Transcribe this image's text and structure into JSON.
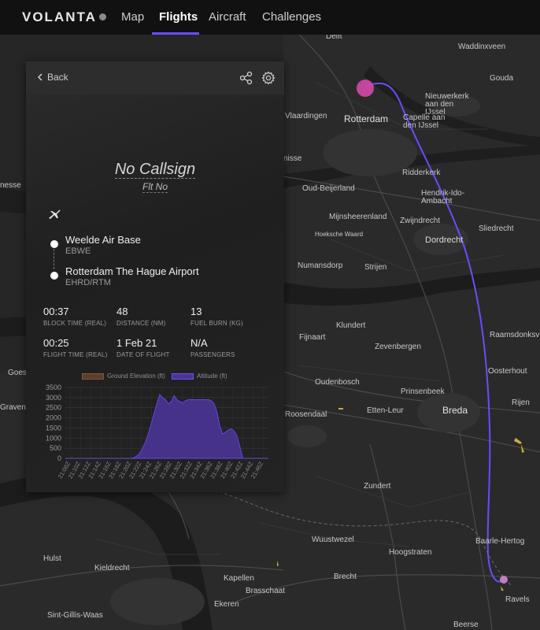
{
  "nav": {
    "brand": "VOLANTA",
    "items": [
      {
        "label": "Map"
      },
      {
        "label": "Flights"
      },
      {
        "label": "Aircraft"
      },
      {
        "label": "Challenges"
      }
    ]
  },
  "map": {
    "places": [
      "Delft",
      "Waddinxveen",
      "Gouda",
      "Nieuwerkerk aan den IJssel",
      "Rotterdam",
      "Vlaardingen",
      "Capelle aan den IJssel",
      "Ridderkerk",
      "Oud-Beijerland",
      "Hendrik-Ido-Ambacht",
      "Mijnsheerenland",
      "Zwijndrecht",
      "Sliedrecht",
      "Hoeksche Waard",
      "Dordrecht",
      "Numansdorp",
      "Strijen",
      "Klundert",
      "Raamsdonksveer",
      "Fijnaart",
      "Zevenbergen",
      "Oosterhout",
      "Oudenbosch",
      "Prinsenbeek",
      "Roosendaal",
      "Etten-Leur",
      "Breda",
      "Rijen",
      "Goes",
      "Gravenpolder",
      "Zundert",
      "Wuustwezel",
      "Hoogstraten",
      "Baarle-Hertog",
      "Hulst",
      "Kieldrecht",
      "Kapellen",
      "Brecht",
      "Ekeren",
      "Brasschaat",
      "Sint-Gillis-Waas",
      "Ravels",
      "Beerse",
      "nisse",
      "nesse",
      "isse"
    ]
  },
  "panel": {
    "back_label": "Back",
    "callsign": "No Callsign",
    "flight_no": "Flt No",
    "origin": {
      "name": "Weelde Air Base",
      "code": "EBWE"
    },
    "destination": {
      "name": "Rotterdam The Hague Airport",
      "code": "EHRD/RTM"
    },
    "stats": [
      {
        "value": "00:37",
        "label": "BLOCK TIME (REAL)"
      },
      {
        "value": "48",
        "label": "DISTANCE (NM)"
      },
      {
        "value": "13",
        "label": "FUEL BURN (KG)"
      },
      {
        "value": "00:25",
        "label": "FLIGHT TIME (REAL)"
      },
      {
        "value": "1 Feb 21",
        "label": "DATE OF FLIGHT"
      },
      {
        "value": "N/A",
        "label": "PASSENGERS"
      }
    ]
  },
  "colors": {
    "accent": "#6a4cff",
    "route": "#6a4cff",
    "altitude_fill": "#4b3496",
    "ground_fill": "#5a3f2c"
  },
  "chart_data": {
    "type": "area",
    "series": [
      {
        "name": "Ground Elevation (ft)",
        "values": [
          0,
          0,
          0,
          0,
          0,
          0,
          0,
          0,
          0,
          0,
          0,
          0,
          0,
          0,
          0,
          0,
          0,
          0,
          0,
          0,
          0,
          0,
          0,
          0,
          0,
          0,
          0,
          0,
          0,
          0,
          0,
          0,
          0,
          0,
          0,
          0,
          0,
          0,
          0,
          0,
          0,
          0,
          0,
          0,
          0,
          0,
          0,
          0,
          0,
          0,
          0,
          0,
          0,
          0,
          0,
          0,
          0,
          0,
          0,
          0,
          0,
          0,
          0,
          0,
          0,
          0,
          0,
          0,
          0,
          0,
          0,
          0
        ]
      },
      {
        "name": "Altitude (ft)",
        "values": [
          0,
          0,
          0,
          0,
          0,
          0,
          0,
          0,
          0,
          0,
          0,
          0,
          0,
          0,
          0,
          0,
          0,
          0,
          0,
          0,
          0,
          0,
          0,
          0,
          30,
          120,
          250,
          500,
          800,
          1200,
          1700,
          2200,
          2700,
          3150,
          3000,
          2900,
          2700,
          2800,
          3100,
          2900,
          2800,
          2750,
          2850,
          2900,
          2900,
          2900,
          2900,
          2900,
          2900,
          2900,
          2900,
          2850,
          2700,
          2300,
          1600,
          1200,
          1300,
          1400,
          1450,
          1350,
          1100,
          600,
          0,
          0,
          0,
          0,
          0,
          0,
          0,
          0,
          0,
          0
        ]
      }
    ],
    "x_ticks": [
      "21:08Z",
      "21:10Z",
      "21:12Z",
      "21:14Z",
      "21:16Z",
      "21:18Z",
      "21:20Z",
      "21:22Z",
      "21:24Z",
      "21:26Z",
      "21:28Z",
      "21:30Z",
      "21:32Z",
      "21:34Z",
      "21:36Z",
      "21:38Z",
      "21:40Z",
      "21:42Z",
      "21:44Z",
      "21:46Z"
    ],
    "x_tick_display": [
      "21:08Z",
      "21:10Z",
      "21:12Z",
      "21:14Z",
      "21:16Z",
      "21:18Z",
      "21:20Z",
      "21:22Z",
      "21:24Z",
      "21:26Z",
      "21:28Z",
      "21:30Z",
      "21:32Z",
      "21:34Z",
      "21:36Z",
      "21:38Z",
      "21:40Z",
      "21:42Z",
      "21:44Z",
      "21:46Z"
    ],
    "y_ticks": [
      "3500",
      "3000",
      "2500",
      "2000",
      "1500",
      "1000",
      "500",
      "0"
    ],
    "ylim": [
      0,
      3500
    ],
    "grid": true,
    "legend": "top"
  }
}
